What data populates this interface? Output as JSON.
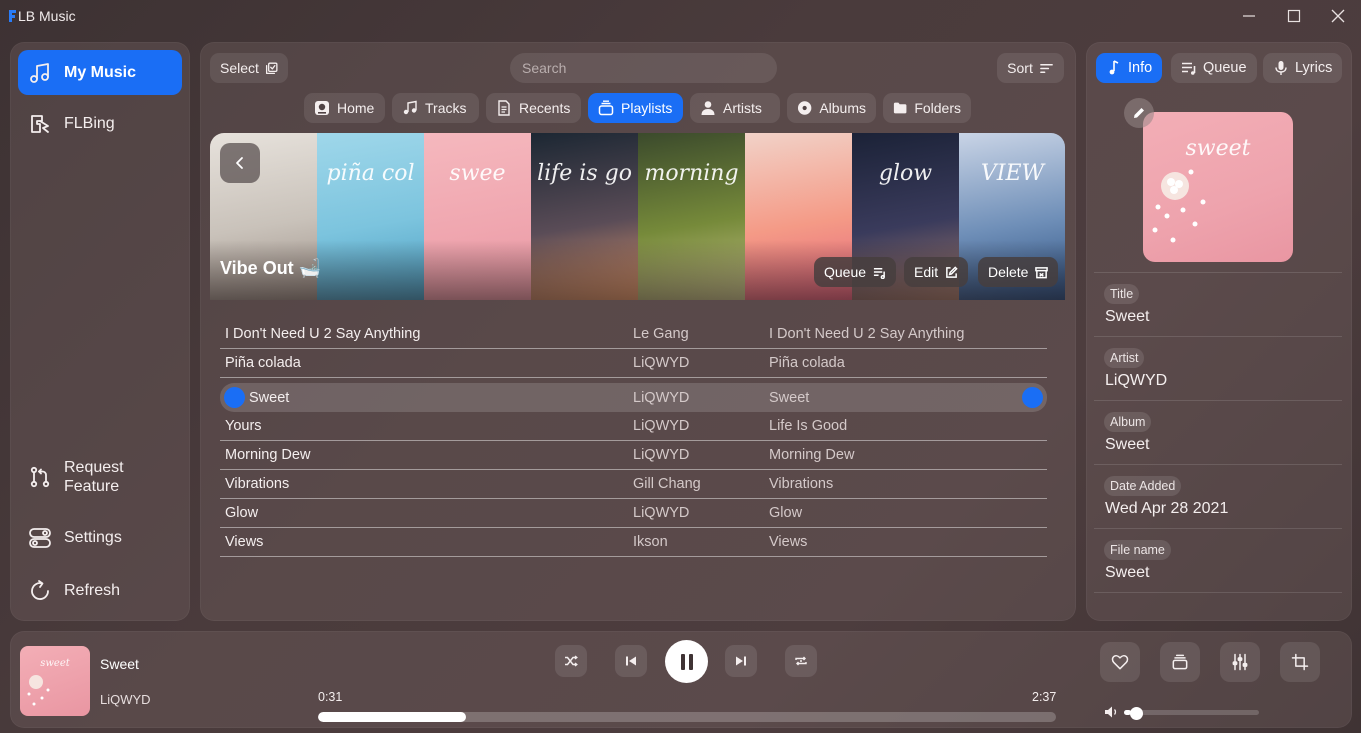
{
  "app": {
    "title": "LB Music"
  },
  "sidebar": {
    "items": [
      {
        "label": "My Music",
        "icon": "music-note-icon",
        "active": true
      },
      {
        "label": "FLBing",
        "icon": "flbing-icon",
        "active": false
      }
    ],
    "bottom_items": [
      {
        "label": "Request Feature",
        "icon": "pull-request-icon"
      },
      {
        "label": "Settings",
        "icon": "toggles-icon"
      },
      {
        "label": "Refresh",
        "icon": "refresh-icon"
      }
    ]
  },
  "toolbar": {
    "select_label": "Select",
    "search_placeholder": "Search",
    "sort_label": "Sort"
  },
  "tabs": [
    {
      "label": "Home",
      "icon": "home-icon"
    },
    {
      "label": "Tracks",
      "icon": "music-note-icon"
    },
    {
      "label": "Recents",
      "icon": "document-icon"
    },
    {
      "label": "Playlists",
      "icon": "playlist-icon",
      "active": true
    },
    {
      "label": "Artists",
      "icon": "person-icon"
    },
    {
      "label": "Albums",
      "icon": "disc-icon"
    },
    {
      "label": "Folders",
      "icon": "folder-icon"
    }
  ],
  "playlist": {
    "name": "Vibe Out 🛁",
    "queue_label": "Queue",
    "edit_label": "Edit",
    "delete_label": "Delete",
    "covers": [
      {
        "text": "",
        "colors": [
          "#e7e2dc",
          "#c9c2ba",
          "#9c8f86"
        ]
      },
      {
        "text": "piña col",
        "colors": [
          "#9fd7ea",
          "#7cc4de",
          "#4a9cbf"
        ]
      },
      {
        "text": "swee",
        "colors": [
          "#f5b8be",
          "#f0a7b0",
          "#e897a3"
        ]
      },
      {
        "text": "life is go",
        "colors": [
          "#1c2733",
          "#5a4c57",
          "#e59a6a"
        ]
      },
      {
        "text": "morning",
        "colors": [
          "#3b4a2c",
          "#768a3a",
          "#c9c38a"
        ]
      },
      {
        "text": "",
        "colors": [
          "#f2d2c8",
          "#f49a86",
          "#e5637c"
        ]
      },
      {
        "text": "glow",
        "colors": [
          "#1b2237",
          "#3a3b5c",
          "#a87d6b"
        ]
      },
      {
        "text": "VIEW",
        "colors": [
          "#c9d4e6",
          "#6f8fb8",
          "#2b4f80"
        ]
      }
    ]
  },
  "tracks": [
    {
      "title": "I Don't Need U 2 Say Anything",
      "artist": "Le Gang",
      "album": "I Don't Need U 2 Say Anything"
    },
    {
      "title": "Piña colada",
      "artist": "LiQWYD",
      "album": "Piña colada"
    },
    {
      "title": "Sweet",
      "artist": "LiQWYD",
      "album": "Sweet",
      "active": true
    },
    {
      "title": "Yours",
      "artist": "LiQWYD",
      "album": "Life Is Good"
    },
    {
      "title": "Morning Dew",
      "artist": "LiQWYD",
      "album": "Morning Dew"
    },
    {
      "title": "Vibrations",
      "artist": "Gill Chang",
      "album": "Vibrations"
    },
    {
      "title": "Glow",
      "artist": "LiQWYD",
      "album": "Glow"
    },
    {
      "title": "Views",
      "artist": "Ikson",
      "album": "Views"
    }
  ],
  "right_panel": {
    "tabs": [
      {
        "label": "Info",
        "icon": "music-note-icon",
        "active": true
      },
      {
        "label": "Queue",
        "icon": "queue-icon"
      },
      {
        "label": "Lyrics",
        "icon": "microphone-icon"
      }
    ],
    "art_text": "sweet",
    "fields": [
      {
        "label": "Title",
        "value": "Sweet"
      },
      {
        "label": "Artist",
        "value": "LiQWYD"
      },
      {
        "label": "Album",
        "value": "Sweet"
      },
      {
        "label": "Date Added",
        "value": "Wed Apr 28 2021"
      },
      {
        "label": "File name",
        "value": "Sweet"
      }
    ]
  },
  "player": {
    "title": "Sweet",
    "artist": "LiQWYD",
    "art_text": "sweet",
    "elapsed": "0:31",
    "duration": "2:37",
    "progress_fraction": 0.2,
    "volume_fraction": 0.05,
    "state": "playing"
  },
  "colors": {
    "accent": "#1a6ef5"
  }
}
